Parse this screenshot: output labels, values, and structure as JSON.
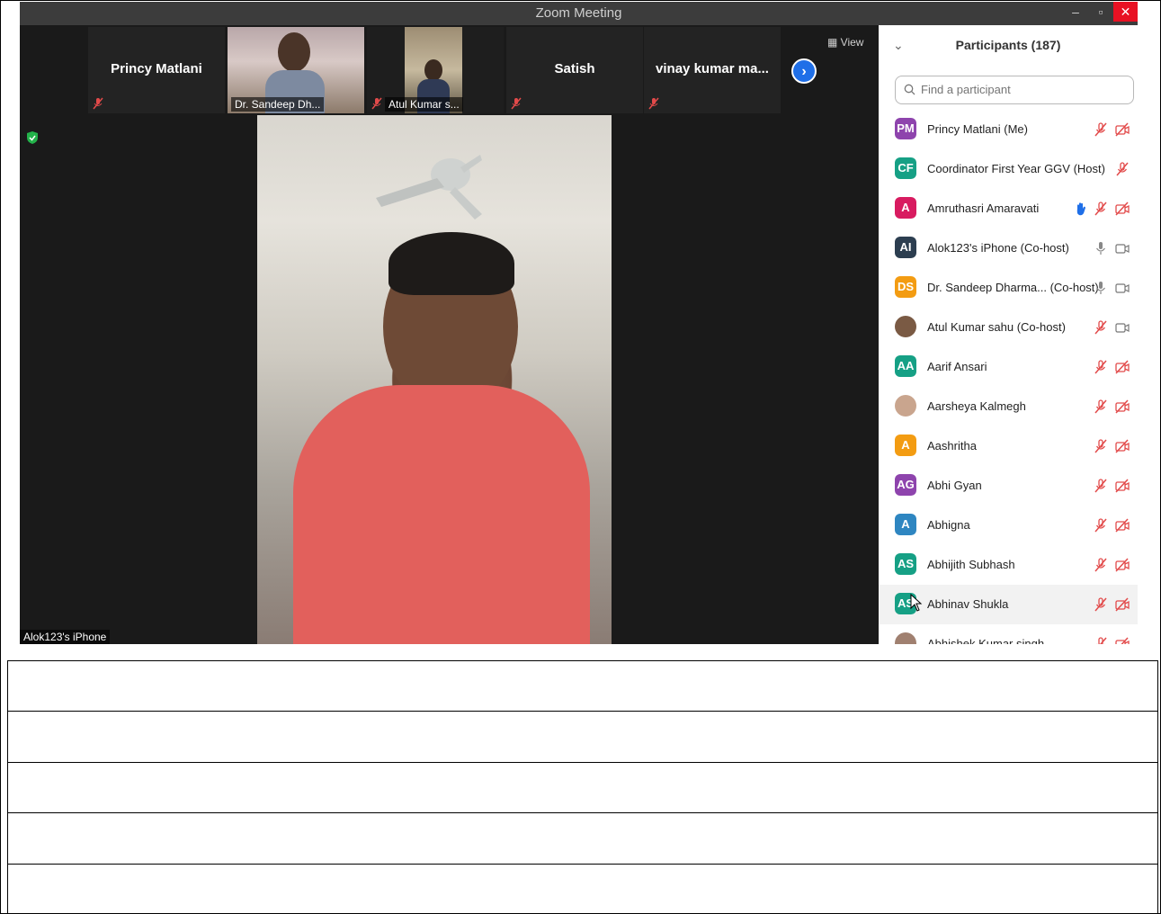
{
  "window": {
    "title": "Zoom Meeting",
    "min_label": "–",
    "max_label": "▫",
    "close_label": "✕"
  },
  "strip": {
    "tiles": [
      {
        "name": "Princy Matlani"
      },
      {
        "label": "Dr. Sandeep Dh..."
      },
      {
        "label": "Atul Kumar s..."
      },
      {
        "name": "Satish"
      },
      {
        "name": "vinay kumar ma..."
      }
    ],
    "next_label": "›",
    "view_label": "View"
  },
  "main_video": {
    "label": "Alok123's iPhone"
  },
  "panel": {
    "title": "Participants (187)",
    "search_placeholder": "Find a participant",
    "participants": [
      {
        "initials": "PM",
        "color": "#8e44ad",
        "name": "Princy Matlani (Me)",
        "icons": [
          "mic-muted-icon",
          "video-off-icon"
        ]
      },
      {
        "initials": "CF",
        "color": "#16a085",
        "name": "Coordinator First Year GGV (Host)",
        "icons": [
          "mic-muted-icon"
        ]
      },
      {
        "initials": "A",
        "color": "#d81b60",
        "name": "Amruthasri Amaravati",
        "icons": [
          "raised-hand-icon",
          "mic-muted-icon",
          "video-off-icon"
        ]
      },
      {
        "initials": "AI",
        "color": "#2c3e50",
        "name": "Alok123's iPhone (Co-host)",
        "icons": [
          "mic-icon",
          "video-icon"
        ]
      },
      {
        "initials": "DS",
        "color": "#f39c12",
        "name": "Dr. Sandeep Dharma...  (Co-host)",
        "icons": [
          "mic-icon",
          "video-icon"
        ]
      },
      {
        "initials": "",
        "color": "#7a5a44",
        "name": "Atul Kumar sahu (Co-host)",
        "icons": [
          "mic-muted-icon",
          "video-icon"
        ]
      },
      {
        "initials": "AA",
        "color": "#16a085",
        "name": "Aarif Ansari",
        "icons": [
          "mic-muted-icon",
          "video-off-icon"
        ]
      },
      {
        "initials": "",
        "color": "#c9a58e",
        "name": "Aarsheya Kalmegh",
        "icons": [
          "mic-muted-icon",
          "video-off-icon"
        ]
      },
      {
        "initials": "A",
        "color": "#f39c12",
        "name": "Aashritha",
        "icons": [
          "mic-muted-icon",
          "video-off-icon"
        ]
      },
      {
        "initials": "AG",
        "color": "#8e44ad",
        "name": "Abhi Gyan",
        "icons": [
          "mic-muted-icon",
          "video-off-icon"
        ]
      },
      {
        "initials": "A",
        "color": "#2e86c1",
        "name": "Abhigna",
        "icons": [
          "mic-muted-icon",
          "video-off-icon"
        ]
      },
      {
        "initials": "AS",
        "color": "#16a085",
        "name": "Abhijith Subhash",
        "icons": [
          "mic-muted-icon",
          "video-off-icon"
        ]
      },
      {
        "initials": "AS",
        "color": "#16a085",
        "name": "Abhinav Shukla",
        "icons": [
          "mic-muted-icon",
          "video-off-icon"
        ]
      },
      {
        "initials": "",
        "color": "#a08070",
        "name": "Abhishek Kumar singh",
        "icons": [
          "mic-muted-icon",
          "video-off-icon"
        ]
      }
    ]
  }
}
